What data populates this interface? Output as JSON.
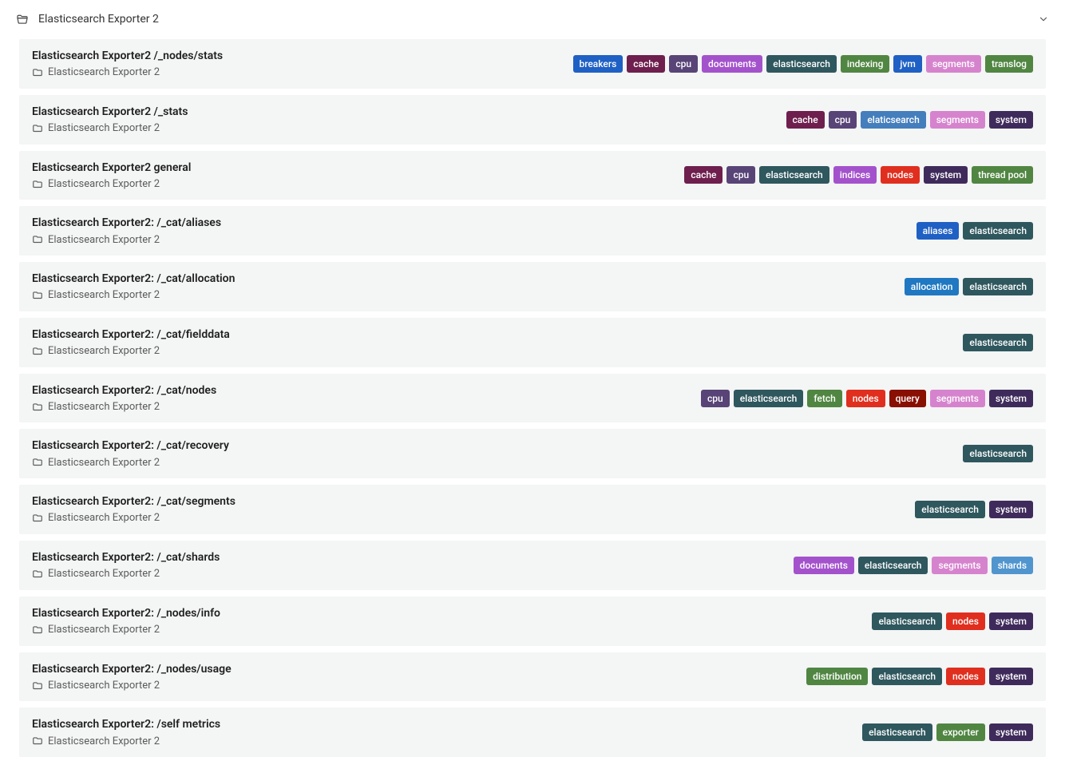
{
  "header": {
    "title": "Elasticsearch Exporter 2"
  },
  "tag_colors": {
    "aliases": "#1f60c4",
    "allocation": "#1f78c1",
    "breakers": "#1f60c4",
    "cache": "#6e1f4e",
    "cpu": "#584477",
    "distribution": "#508642",
    "documents": "#a352cc",
    "elasticsearch": "#2f575e",
    "elaticsearch": "#447ebc",
    "exporter": "#508642",
    "fetch": "#508642",
    "indexing": "#508642",
    "indices": "#a352cc",
    "jvm": "#1f60c4",
    "nodes": "#e02f1f",
    "query": "#890f02",
    "segments": "#d683ce",
    "shards": "#5195ce",
    "system": "#3f2b5b",
    "thread pool": "#508642",
    "translog": "#508642"
  },
  "items": [
    {
      "title": "Elasticsearch Exporter2 /_nodes/stats",
      "folder": "Elasticsearch Exporter 2",
      "tags": [
        "breakers",
        "cache",
        "cpu",
        "documents",
        "elasticsearch",
        "indexing",
        "jvm",
        "segments",
        "translog"
      ]
    },
    {
      "title": "Elasticsearch Exporter2 /_stats",
      "folder": "Elasticsearch Exporter 2",
      "tags": [
        "cache",
        "cpu",
        "elaticsearch",
        "segments",
        "system"
      ]
    },
    {
      "title": "Elasticsearch Exporter2 general",
      "folder": "Elasticsearch Exporter 2",
      "tags": [
        "cache",
        "cpu",
        "elasticsearch",
        "indices",
        "nodes",
        "system",
        "thread pool"
      ]
    },
    {
      "title": "Elasticsearch Exporter2: /_cat/aliases",
      "folder": "Elasticsearch Exporter 2",
      "tags": [
        "aliases",
        "elasticsearch"
      ]
    },
    {
      "title": "Elasticsearch Exporter2: /_cat/allocation",
      "folder": "Elasticsearch Exporter 2",
      "tags": [
        "allocation",
        "elasticsearch"
      ]
    },
    {
      "title": "Elasticsearch Exporter2: /_cat/fielddata",
      "folder": "Elasticsearch Exporter 2",
      "tags": [
        "elasticsearch"
      ]
    },
    {
      "title": "Elasticsearch Exporter2: /_cat/nodes",
      "folder": "Elasticsearch Exporter 2",
      "tags": [
        "cpu",
        "elasticsearch",
        "fetch",
        "nodes",
        "query",
        "segments",
        "system"
      ]
    },
    {
      "title": "Elasticsearch Exporter2: /_cat/recovery",
      "folder": "Elasticsearch Exporter 2",
      "tags": [
        "elasticsearch"
      ]
    },
    {
      "title": "Elasticsearch Exporter2: /_cat/segments",
      "folder": "Elasticsearch Exporter 2",
      "tags": [
        "elasticsearch",
        "system"
      ]
    },
    {
      "title": "Elasticsearch Exporter2: /_cat/shards",
      "folder": "Elasticsearch Exporter 2",
      "tags": [
        "documents",
        "elasticsearch",
        "segments",
        "shards"
      ]
    },
    {
      "title": "Elasticsearch Exporter2: /_nodes/info",
      "folder": "Elasticsearch Exporter 2",
      "tags": [
        "elasticsearch",
        "nodes",
        "system"
      ]
    },
    {
      "title": "Elasticsearch Exporter2: /_nodes/usage",
      "folder": "Elasticsearch Exporter 2",
      "tags": [
        "distribution",
        "elasticsearch",
        "nodes",
        "system"
      ]
    },
    {
      "title": "Elasticsearch Exporter2: /self metrics",
      "folder": "Elasticsearch Exporter 2",
      "tags": [
        "elasticsearch",
        "exporter",
        "system"
      ]
    }
  ]
}
